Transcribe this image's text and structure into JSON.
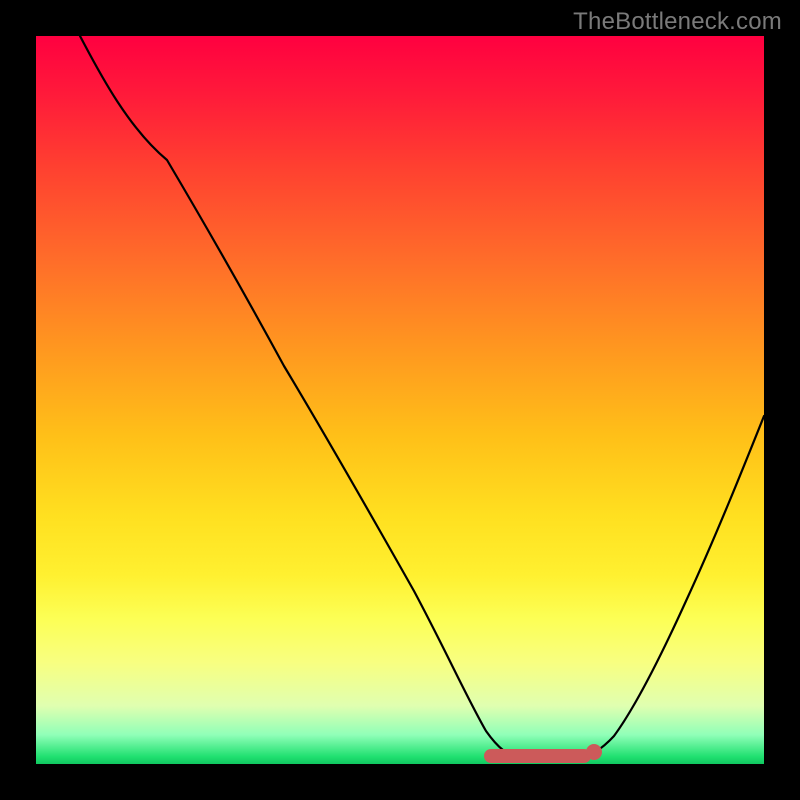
{
  "watermark": {
    "text": "TheBottleneck.com"
  },
  "chart_data": {
    "type": "line",
    "title": "",
    "xlabel": "",
    "ylabel": "",
    "xlim": [
      0,
      100
    ],
    "ylim": [
      0,
      100
    ],
    "grid": false,
    "legend": false,
    "description": "Bottleneck curve: V-shaped black line on red-to-green vertical gradient, minimum (green/optimal) plateau around x≈62–75; highlighted in dark pink.",
    "series": [
      {
        "name": "bottleneck-curve",
        "x": [
          6,
          10,
          18,
          26,
          34,
          42,
          50,
          56,
          60,
          63,
          66,
          70,
          74,
          77,
          80,
          84,
          88,
          92,
          96,
          100
        ],
        "values": [
          99,
          94,
          83,
          71,
          59,
          47,
          35,
          23,
          13,
          5,
          1,
          0,
          0,
          1,
          4,
          11,
          21,
          33,
          45,
          55
        ]
      }
    ],
    "highlight": {
      "name": "optimal-range",
      "x_start": 62,
      "x_end": 76,
      "color": "#cc5a5a"
    },
    "background_gradient": {
      "direction": "vertical",
      "stops": [
        {
          "pos": 0.0,
          "color": "#ff0040"
        },
        {
          "pos": 0.5,
          "color": "#ffc018"
        },
        {
          "pos": 0.85,
          "color": "#fcff70"
        },
        {
          "pos": 1.0,
          "color": "#10c860"
        }
      ]
    }
  }
}
